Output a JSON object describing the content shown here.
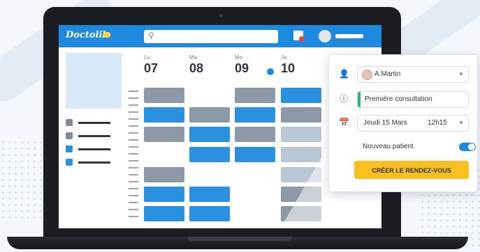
{
  "app": {
    "logo_text": "Doctolib"
  },
  "search": {
    "placeholder": ""
  },
  "days": [
    {
      "name": "Lu",
      "num": "07"
    },
    {
      "name": "Ma",
      "num": "08"
    },
    {
      "name": "Me",
      "num": "09"
    },
    {
      "name": "Je",
      "num": "10"
    }
  ],
  "popup": {
    "practitioner": "A.Martin",
    "reason": "Première consultation",
    "date": "Jeudi 15 Mars",
    "time": "12h15",
    "new_patient_label": "Nouveau patient",
    "new_patient_on": true,
    "cta_label": "CRÉER LE RENDEZ-VOUS"
  },
  "colors": {
    "brand_blue": "#1d8ae0",
    "cta_yellow": "#fbbf1f",
    "slot_gray": "#8d99a6",
    "reason_green": "#2bb673"
  },
  "icons": [
    "search-icon",
    "calendar-icon",
    "user-icon",
    "info-icon",
    "calendar-date-icon",
    "chevron-down-icon"
  ]
}
